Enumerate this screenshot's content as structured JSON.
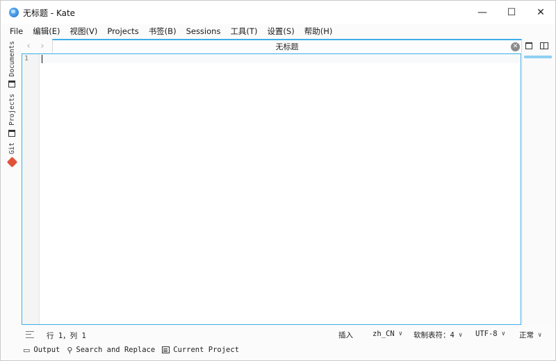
{
  "window": {
    "title": "无标题  - Kate",
    "controls": {
      "minimize": "—",
      "maximize": "☐",
      "close": "✕"
    }
  },
  "menubar": {
    "items": [
      "File",
      "编辑(E)",
      "视图(V)",
      "Projects",
      "书签(B)",
      "Sessions",
      "工具(T)",
      "设置(S)",
      "帮助(H)"
    ]
  },
  "left_panel": {
    "tabs": [
      {
        "label": "Documents",
        "icon": "document-icon"
      },
      {
        "label": "Projects",
        "icon": "project-icon"
      },
      {
        "label": "Git",
        "icon": "git-icon"
      }
    ]
  },
  "tabbar": {
    "back_arrow": "‹",
    "forward_arrow": "›",
    "active_tab": "无标题",
    "close_glyph": "✕"
  },
  "editor": {
    "line_numbers": [
      "1"
    ],
    "content": ""
  },
  "statusbar": {
    "cursor_position": "行 1，列 1",
    "input_mode": "插入",
    "language": "zh_CN",
    "indentation": "软制表符：4",
    "encoding": "UTF-8",
    "mode": "正常"
  },
  "bottom_tools": {
    "output": "Output",
    "search_replace": "Search and Replace",
    "current_project": "Current Project"
  },
  "colors": {
    "accent": "#3daee9",
    "git_icon": "#e0533a"
  }
}
